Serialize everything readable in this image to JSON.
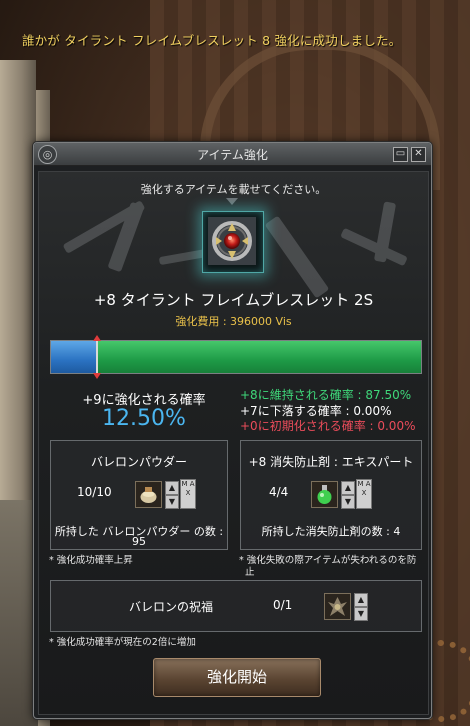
{
  "notice": "誰かが タイラント フレイムブレスレット 8 強化に成功しました。",
  "window": {
    "title": "アイテム強化",
    "close_label": "✕"
  },
  "instruction": "強化するアイテムを載せてください。",
  "item": {
    "name": "+8 タイラント フレイムブレスレット 2S",
    "cost": "強化費用 : 396000 Vis",
    "icon": "bracelet-icon"
  },
  "progress": {
    "success_fraction": 0.125,
    "keep_fraction": 0.875
  },
  "rates": {
    "success_label": "+9に強化される確率",
    "success_value": "12.50%",
    "keep": "+8に維持される確率 : 87.50%",
    "drop": "+7に下落する確率 : 0.00%",
    "reset": "+0に初期化される確率 : 0.00%"
  },
  "powder": {
    "title": "バレロンパウダー",
    "count": "10/10",
    "owned": "所持した バレロンパウダー の数 :",
    "owned_count": "95",
    "note": "* 強化成功確率上昇",
    "icon": "powder-icon"
  },
  "prevent": {
    "title": "+8 消失防止剤 : エキスパート",
    "count": "4/4",
    "owned": "所持した消失防止剤の数 : 4",
    "note_line1": "* 強化失敗の際アイテムが失われるのを防",
    "note_line2": "止",
    "icon": "potion-icon"
  },
  "blessing": {
    "title": "バレロンの祝福",
    "count": "0/1",
    "note": "* 強化成功確率が現在の2倍に増加",
    "icon": "blessing-icon"
  },
  "controls": {
    "up": "▲",
    "down": "▼",
    "max": "M A X"
  },
  "start_button": "強化開始",
  "colors": {
    "success": "#4bb6f0",
    "keep": "#3fd77a",
    "reset": "#ea4c5a",
    "cost": "#e9c14a",
    "notice": "#f0d060"
  }
}
